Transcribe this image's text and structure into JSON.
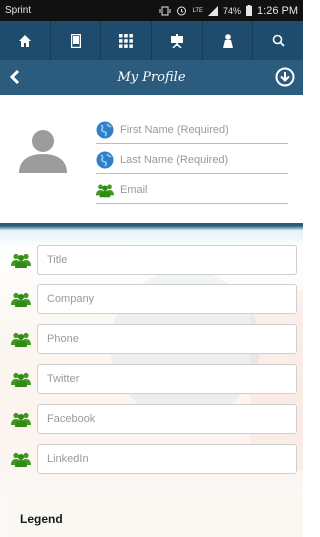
{
  "status_bar": {
    "carrier": "Sprint",
    "network": "LTE",
    "battery": "74%",
    "time": "1:26 PM"
  },
  "nav": {
    "items": [
      {
        "icon": "home-icon"
      },
      {
        "icon": "phone-icon"
      },
      {
        "icon": "grid-icon"
      },
      {
        "icon": "presentation-icon"
      },
      {
        "icon": "person-icon"
      },
      {
        "icon": "search-icon"
      }
    ]
  },
  "header": {
    "title": "My Profile",
    "back_icon": "chevron-left-icon",
    "action_icon": "download-circle-icon"
  },
  "profile": {
    "first_name_placeholder": "First Name (Required)",
    "last_name_placeholder": "Last Name (Required)",
    "email_placeholder": "Email"
  },
  "form": {
    "fields": [
      {
        "placeholder": "Title"
      },
      {
        "placeholder": "Company"
      },
      {
        "placeholder": "Phone"
      },
      {
        "placeholder": "Twitter"
      },
      {
        "placeholder": "Facebook"
      },
      {
        "placeholder": "LinkedIn"
      }
    ]
  },
  "legend": {
    "title": "Legend"
  },
  "colors": {
    "nav_bar": "#1f4c6c",
    "title_bar": "#2b5c7e",
    "globe_icon": "#2f7fc9",
    "people_icon": "#3d9a1f"
  }
}
